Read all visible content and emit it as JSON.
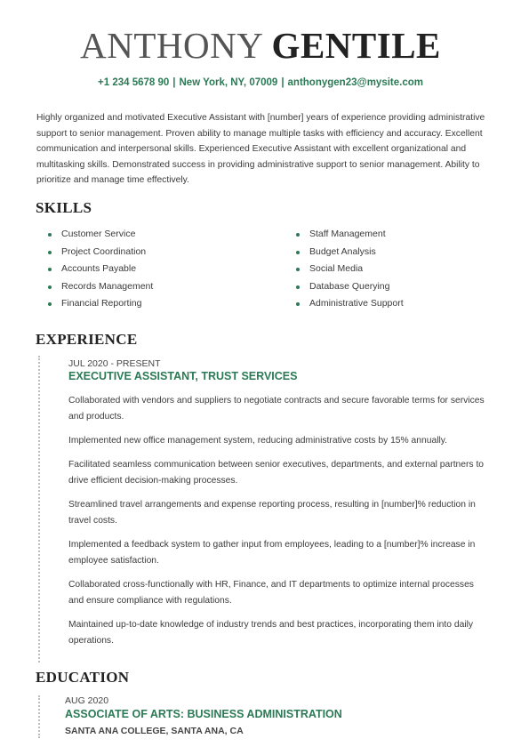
{
  "header": {
    "first_name": "ANTHONY",
    "last_name": "GENTILE",
    "phone": "+1 234 5678 90",
    "location": "New York, NY, 07009",
    "email": "anthonygen23@mysite.com",
    "separator": "|"
  },
  "summary": "Highly organized and motivated Executive Assistant with [number] years of experience providing administrative support to senior management. Proven ability to manage multiple tasks with efficiency and accuracy. Excellent communication and interpersonal skills. Experienced Executive Assistant with excellent organizational and multitasking skills. Demonstrated success in providing administrative support to senior management. Ability to prioritize and manage time effectively.",
  "skills": {
    "title": "SKILLS",
    "left": [
      "Customer Service",
      "Project Coordination",
      "Accounts Payable",
      "Records Management",
      "Financial Reporting"
    ],
    "right": [
      "Staff Management",
      "Budget Analysis",
      "Social Media",
      "Database Querying",
      "Administrative Support"
    ]
  },
  "experience": {
    "title": "EXPERIENCE",
    "entries": [
      {
        "date": "JUL 2020 - PRESENT",
        "role": "EXECUTIVE ASSISTANT, TRUST SERVICES",
        "bullets": [
          "Collaborated with vendors and suppliers to negotiate contracts and secure favorable terms for services and products.",
          "Implemented new office management system, reducing administrative costs by 15% annually.",
          "Facilitated seamless communication between senior executives, departments, and external partners to drive efficient decision-making processes.",
          "Streamlined travel arrangements and expense reporting process, resulting in [number]% reduction in travel costs.",
          "Implemented a feedback system to gather input from employees, leading to a [number]% increase in employee satisfaction.",
          "Collaborated cross-functionally with HR, Finance, and IT departments to optimize internal processes and ensure compliance with regulations.",
          "Maintained up-to-date knowledge of industry trends and best practices, incorporating them into daily operations."
        ]
      }
    ]
  },
  "education": {
    "title": "EDUCATION",
    "entries": [
      {
        "date": "AUG 2020",
        "degree": "ASSOCIATE OF ARTS: BUSINESS ADMINISTRATION",
        "school": "SANTA ANA COLLEGE, SANTA ANA, CA"
      }
    ]
  },
  "colors": {
    "accent": "#2b7a55",
    "heading": "#222222",
    "body": "#3a3a3a"
  }
}
